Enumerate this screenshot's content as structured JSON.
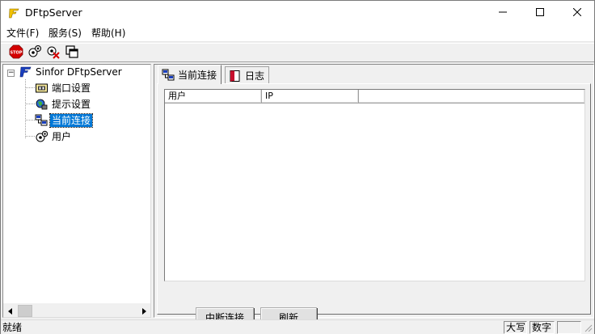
{
  "window": {
    "title": "DFtpServer",
    "controls": {
      "minimize": "minimize-icon",
      "maximize": "maximize-icon",
      "close": "close-icon"
    }
  },
  "menu": {
    "items": [
      "文件(F)",
      "服务(S)",
      "帮助(H)"
    ]
  },
  "toolbar": {
    "icons": [
      "stop-icon",
      "connect-icon",
      "disconnect-icon",
      "copy-windows-icon"
    ],
    "stop_text": "STOP"
  },
  "tree": {
    "root": "Sinfor DFtpServer",
    "expander": "−",
    "children": [
      {
        "label": "端口设置",
        "icon": "port-settings-icon"
      },
      {
        "label": "提示设置",
        "icon": "prompt-settings-icon"
      },
      {
        "label": "当前连接",
        "icon": "current-connections-icon",
        "selected": true
      },
      {
        "label": "用户",
        "icon": "users-icon"
      }
    ]
  },
  "tabs": [
    {
      "label": "当前连接",
      "icon": "connections-tab-icon",
      "active": true
    },
    {
      "label": "日志",
      "icon": "log-tab-icon",
      "active": false
    }
  ],
  "listview": {
    "columns": [
      "用户",
      "IP",
      ""
    ]
  },
  "buttons": {
    "disconnect": "中断连接",
    "refresh": "刷新"
  },
  "status": {
    "main": "就绪",
    "caps": "大写",
    "num": "数字",
    "scroll": ""
  },
  "colors": {
    "selection": "#0078d7",
    "background": "#f0f0f0"
  }
}
